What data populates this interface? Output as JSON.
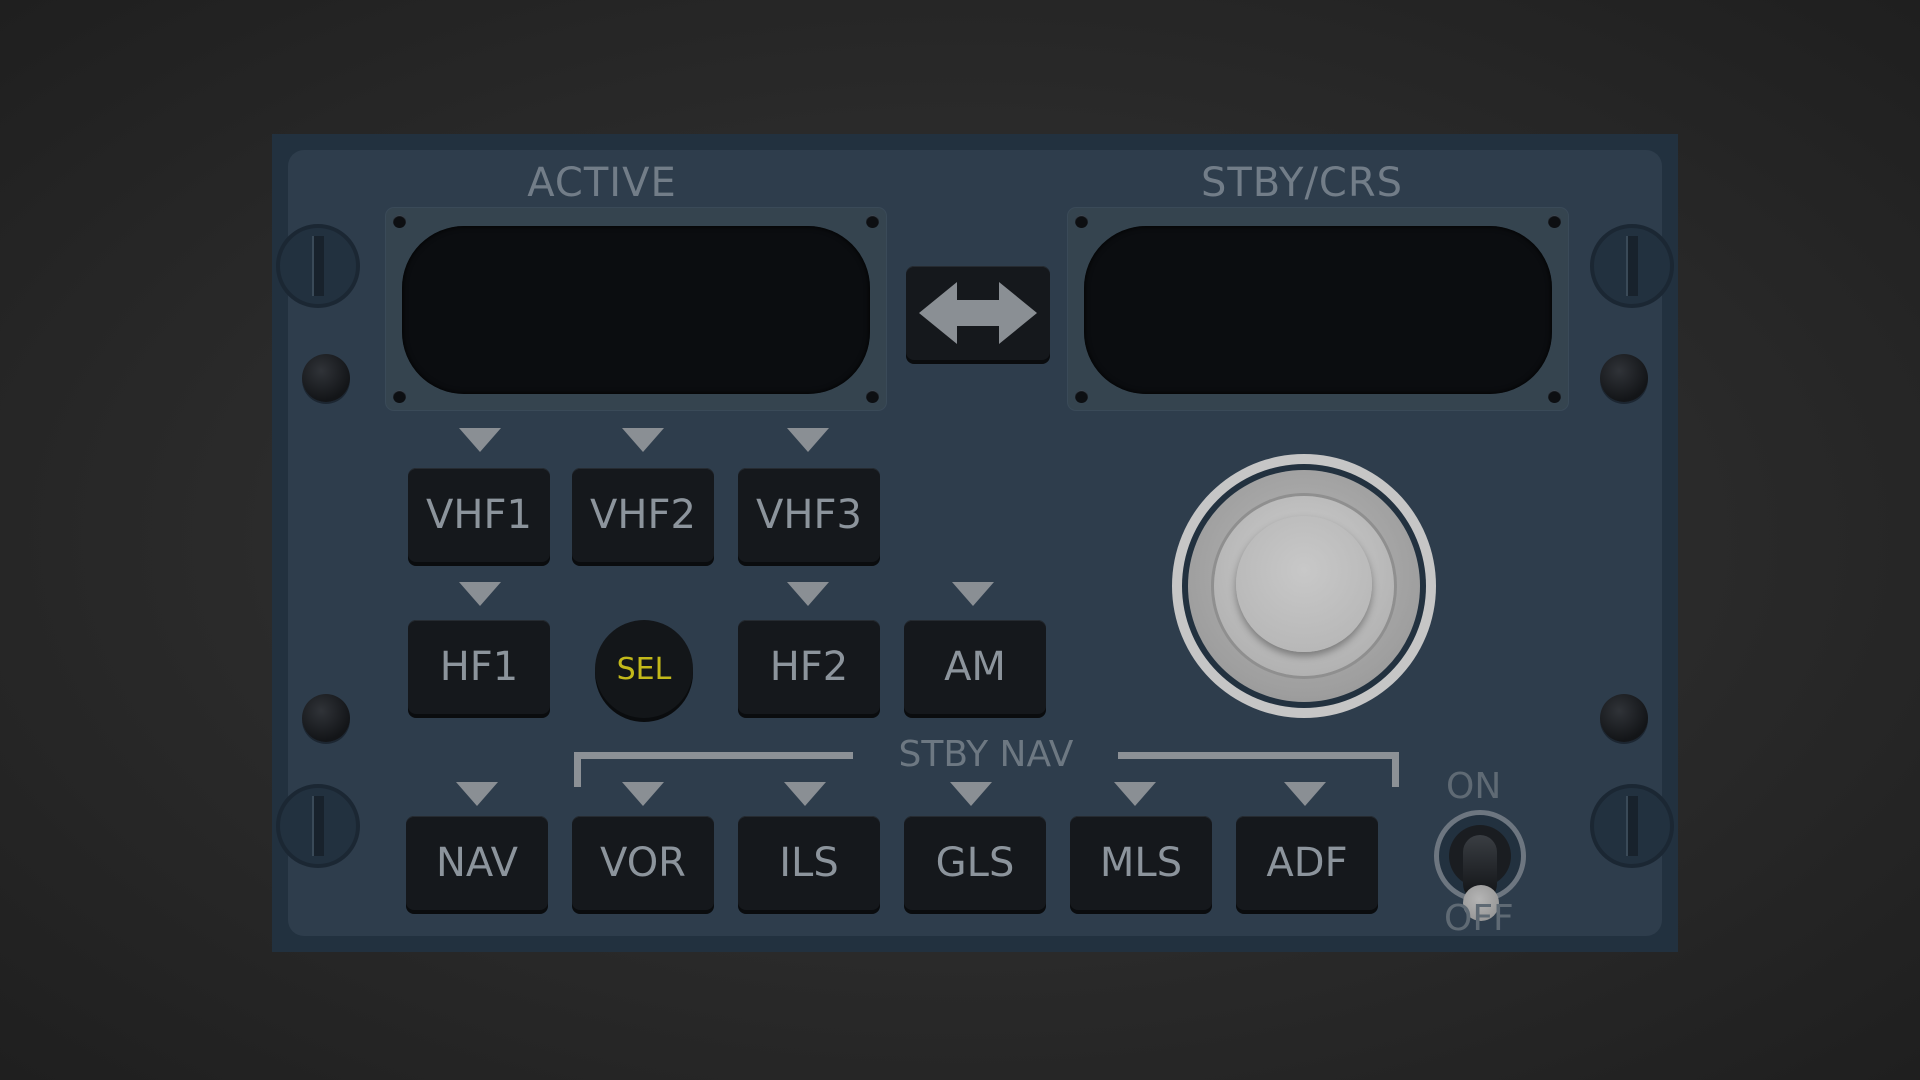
{
  "panel": {
    "active_label": "ACTIVE",
    "standby_label": "STBY/CRS",
    "stby_nav_label": "STBY NAV",
    "transfer_icon": "double-arrow-icon"
  },
  "buttons": {
    "vhf1": "VHF1",
    "vhf2": "VHF2",
    "vhf3": "VHF3",
    "hf1": "HF1",
    "sel": "SEL",
    "hf2": "HF2",
    "am": "AM",
    "nav": "NAV",
    "vor": "VOR",
    "ils": "ILS",
    "gls": "GLS",
    "mls": "MLS",
    "adf": "ADF"
  },
  "switch": {
    "on_label": "ON",
    "off_label": "OFF"
  },
  "colors": {
    "panel": "#2e3d4c",
    "button": "#15181c",
    "button_text": "#8c949c",
    "sel_text": "#c3b91a",
    "indicator": "#8a8f94"
  }
}
